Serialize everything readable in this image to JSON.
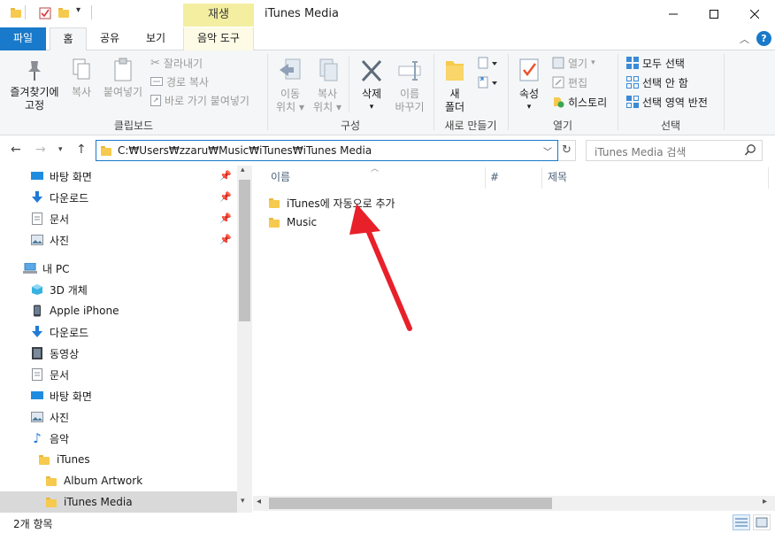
{
  "window": {
    "title": "iTunes Media",
    "contextual_tab_label": "재생"
  },
  "tabs": [
    {
      "label": "파일"
    },
    {
      "label": "홈"
    },
    {
      "label": "공유"
    },
    {
      "label": "보기"
    },
    {
      "label": "음악 도구"
    }
  ],
  "ribbon": {
    "clipboard": {
      "group_label": "클립보드",
      "pin_label_1": "즐겨찾기에",
      "pin_label_2": "고정",
      "copy_label": "복사",
      "paste_label": "붙여넣기",
      "cut_label": "잘라내기",
      "copy_path_label": "경로 복사",
      "paste_shortcut_label": "바로 가기 붙여넣기"
    },
    "organize": {
      "group_label": "구성",
      "move_label_1": "이동",
      "move_label_2": "위치",
      "copy_to_label_1": "복사",
      "copy_to_label_2": "위치",
      "delete_label": "삭제",
      "rename_label_1": "이름",
      "rename_label_2": "바꾸기"
    },
    "new": {
      "group_label": "새로 만들기",
      "new_folder_label_1": "새",
      "new_folder_label_2": "폴더"
    },
    "open": {
      "group_label": "열기",
      "properties_label": "속성",
      "open_label": "열기",
      "edit_label": "편집",
      "history_label": "히스토리"
    },
    "select": {
      "group_label": "선택",
      "select_all_label": "모두 선택",
      "select_none_label": "선택 안 함",
      "invert_label": "선택 영역 반전"
    }
  },
  "address": {
    "path": "C:₩Users₩zzaru₩Music₩iTunes₩iTunes Media",
    "search_placeholder": "iTunes Media 검색"
  },
  "nav_pane": {
    "quick_access": [
      {
        "label": "바탕 화면",
        "icon": "desktop-icon",
        "pinned": true
      },
      {
        "label": "다운로드",
        "icon": "download-icon",
        "pinned": true
      },
      {
        "label": "문서",
        "icon": "document-icon",
        "pinned": true
      },
      {
        "label": "사진",
        "icon": "picture-icon",
        "pinned": true
      }
    ],
    "this_pc_label": "내 PC",
    "this_pc_items": [
      {
        "label": "3D 개체",
        "icon": "3d-objects-icon"
      },
      {
        "label": "Apple iPhone",
        "icon": "iphone-icon"
      },
      {
        "label": "다운로드",
        "icon": "download-icon"
      },
      {
        "label": "동영상",
        "icon": "video-icon"
      },
      {
        "label": "문서",
        "icon": "document-icon"
      },
      {
        "label": "바탕 화면",
        "icon": "desktop-icon"
      },
      {
        "label": "사진",
        "icon": "picture-icon"
      },
      {
        "label": "음악",
        "icon": "music-icon"
      }
    ],
    "itunes_label": "iTunes",
    "album_artwork_label": "Album Artwork",
    "itunes_media_label": "iTunes Media"
  },
  "content": {
    "columns": [
      {
        "label": "이름"
      },
      {
        "label": "#"
      },
      {
        "label": "제목"
      }
    ],
    "files": [
      {
        "name": "iTunes에 자동으로 추가"
      },
      {
        "name": "Music"
      }
    ]
  },
  "status": {
    "item_count": "2개 항목"
  },
  "colors": {
    "file_tab": "#1979ca",
    "contextual_tab": "#f3eea0",
    "selected_nav": "#d9d9d9",
    "arrow": "#e8202a",
    "folder": "#f6ca4e"
  }
}
